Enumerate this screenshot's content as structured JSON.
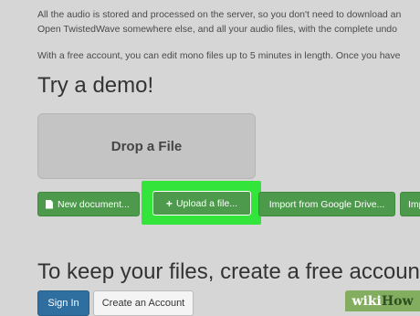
{
  "intro": {
    "line1": "All the audio is stored and processed on the server, so you don't need to download an",
    "line2": "Open TwistedWave somewhere else, and all your audio files, with the complete undo",
    "line3": "With a free account, you can edit mono files up to 5 minutes in length. Once you have"
  },
  "demo": {
    "heading": "Try a demo!",
    "drop_label": "Drop a File"
  },
  "actions": {
    "new_document": "New document...",
    "upload": "Upload a file...",
    "import_drive": "Import from Google Drive...",
    "import_more": "Imp"
  },
  "account": {
    "heading": "To keep your files, create a free account",
    "sign_in": "Sign In",
    "create": "Create an Account"
  },
  "watermark": {
    "part1": "wiki",
    "part2": "How"
  },
  "colors": {
    "background": "#d6d6d6",
    "button_green": "#4e9a4c",
    "highlight_green": "#33e43a",
    "sign_in_blue": "#2f6f9f"
  },
  "icons": {
    "new_document": "document-icon",
    "upload": "plus-icon"
  }
}
